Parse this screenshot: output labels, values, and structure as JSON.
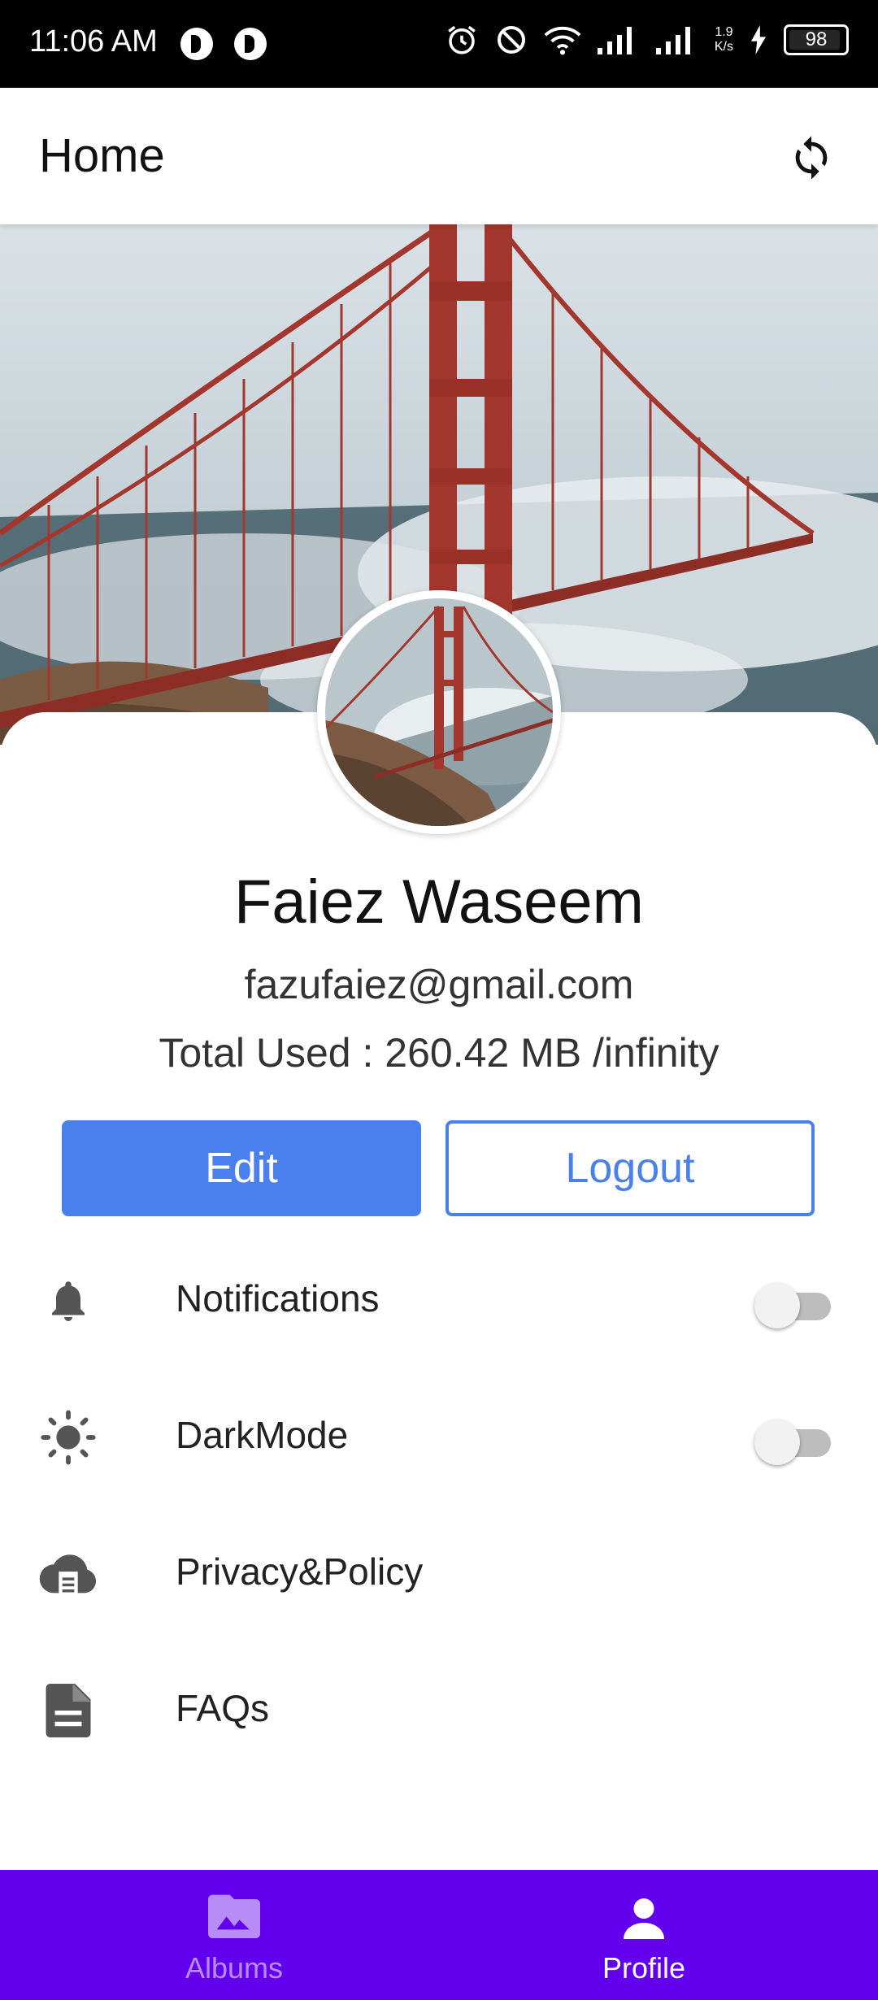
{
  "status_bar": {
    "time": "11:06 AM",
    "net_speed_value": "1.9",
    "net_speed_unit": "K/s",
    "battery": "98"
  },
  "app_bar": {
    "title": "Home",
    "refresh_icon": "refresh-icon"
  },
  "profile": {
    "name": "Faiez Waseem",
    "email": "fazufaiez@gmail.com",
    "usage": "Total Used : 260.42 MB /infinity"
  },
  "actions": {
    "edit_label": "Edit",
    "logout_label": "Logout"
  },
  "settings": [
    {
      "label": "Notifications",
      "icon": "bell-icon",
      "toggle": false
    },
    {
      "label": "DarkMode",
      "icon": "brightness-icon",
      "toggle": false
    },
    {
      "label": "Privacy&Policy",
      "icon": "cloud-document-icon"
    },
    {
      "label": "FAQs",
      "icon": "document-icon"
    }
  ],
  "bottom_nav": {
    "items": [
      {
        "label": "Albums",
        "icon": "photo-album-icon",
        "active": false
      },
      {
        "label": "Profile",
        "icon": "person-icon",
        "active": true
      }
    ]
  },
  "colors": {
    "primary_button": "#4a80ed",
    "bottom_nav": "#6200ee",
    "status_bar": "#000000"
  }
}
